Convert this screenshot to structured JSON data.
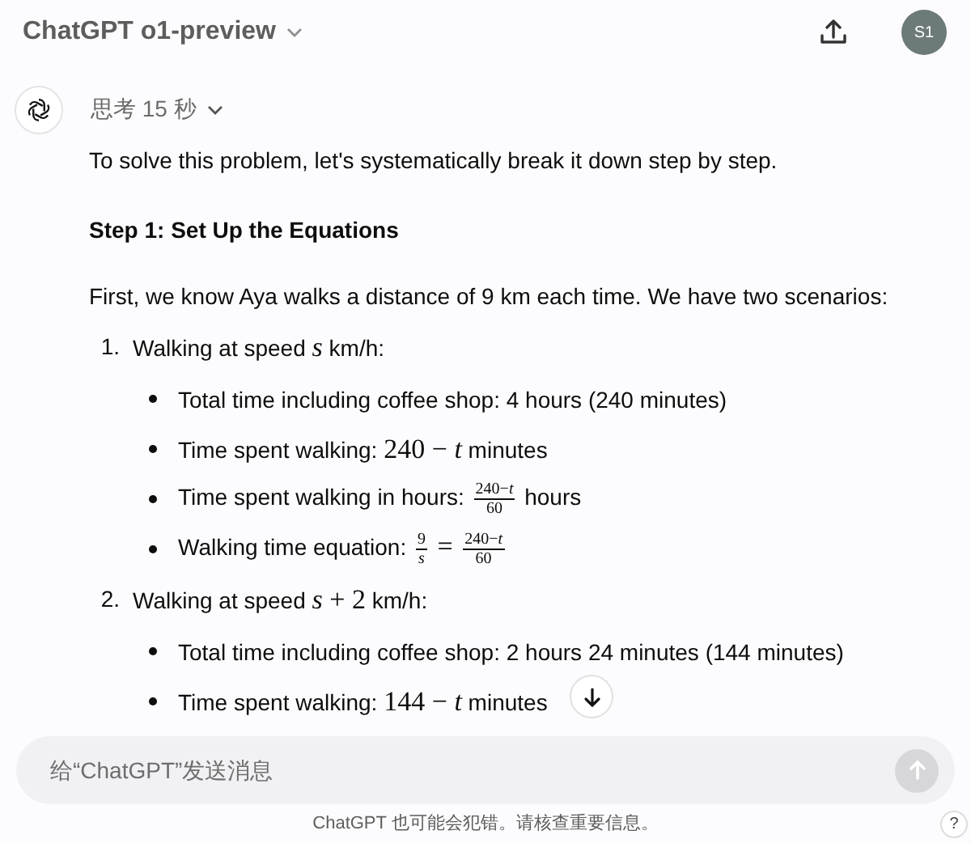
{
  "header": {
    "title": "ChatGPT o1-preview",
    "avatar": "S1"
  },
  "thinking": "思考 15 秒",
  "blocks": [
    {
      "kind": "paragraph",
      "parts": [
        {
          "kind": "text",
          "text": "To solve this problem, let's systematically break it down step by step."
        }
      ]
    },
    {
      "kind": "heading",
      "parts": [
        {
          "kind": "text",
          "text": "Step 1: Set Up the Equations"
        }
      ]
    },
    {
      "kind": "paragraph",
      "parts": [
        {
          "kind": "text",
          "text": "First, we know Aya walks a distance of 9 km each time. We have two scenarios:"
        }
      ]
    },
    {
      "kind": "numbered",
      "number": "1.",
      "parts": [
        {
          "kind": "text",
          "text": "Walking at speed "
        },
        {
          "kind": "math",
          "text": "*s*"
        },
        {
          "kind": "text",
          "text": " km/h:"
        }
      ],
      "bullets": [
        {
          "parts": [
            {
              "kind": "text",
              "text": "Total time including coffee shop: 4 hours (240 minutes)"
            }
          ]
        },
        {
          "parts": [
            {
              "kind": "text",
              "text": "Time spent walking: "
            },
            {
              "kind": "math",
              "text": "240 − *t*"
            },
            {
              "kind": "text",
              "text": " minutes"
            }
          ]
        },
        {
          "parts": [
            {
              "kind": "text",
              "text": "Time spent walking in hours: "
            },
            {
              "kind": "frac",
              "num": "240−*t*",
              "den": "60"
            },
            {
              "kind": "text",
              "text": " hours"
            }
          ]
        },
        {
          "parts": [
            {
              "kind": "text",
              "text": "Walking time equation: "
            },
            {
              "kind": "frac",
              "num": "9",
              "den": "*s*"
            },
            {
              "kind": "math",
              "text": " = "
            },
            {
              "kind": "frac",
              "num": "240−*t*",
              "den": "60"
            }
          ]
        }
      ]
    },
    {
      "kind": "numbered",
      "number": "2.",
      "parts": [
        {
          "kind": "text",
          "text": "Walking at speed "
        },
        {
          "kind": "math",
          "text": "*s* + 2"
        },
        {
          "kind": "text",
          "text": " km/h:"
        }
      ],
      "bullets": [
        {
          "parts": [
            {
              "kind": "text",
              "text": "Total time including coffee shop: 2 hours 24 minutes (144 minutes)"
            }
          ]
        },
        {
          "parts": [
            {
              "kind": "text",
              "text": "Time spent walking: "
            },
            {
              "kind": "math",
              "text": "144 − *t*"
            },
            {
              "kind": "text",
              "text": " minutes"
            }
          ]
        }
      ]
    }
  ],
  "composer": {
    "placeholder": "给“ChatGPT”发送消息"
  },
  "footer": "ChatGPT 也可能会犯错。请核查重要信息。",
  "help": "?"
}
